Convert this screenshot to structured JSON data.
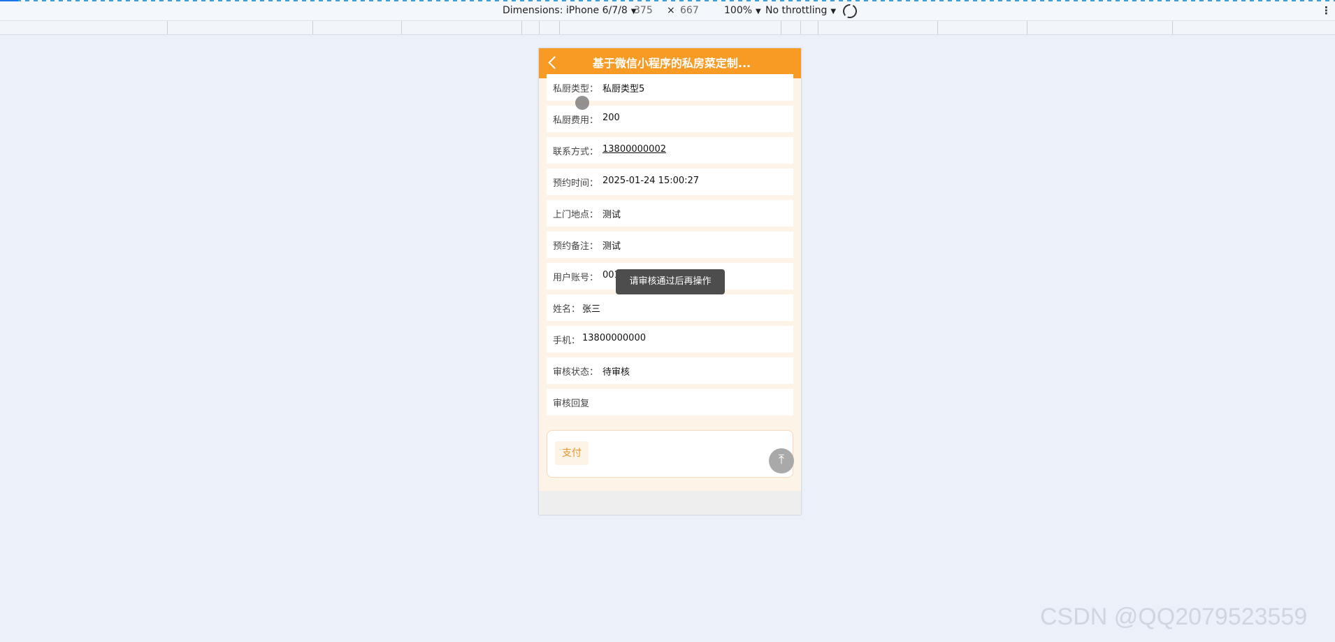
{
  "devtools": {
    "dimensions_label": "Dimensions: iPhone 6/7/8",
    "width": "375",
    "times": "×",
    "height": "667",
    "zoom": "100%",
    "throttling": "No throttling",
    "caret": "▼",
    "more": "⋮"
  },
  "nav": {
    "title": "基于微信小程序的私房菜定制..."
  },
  "fields": [
    {
      "label": "私厨类型：",
      "value": "私厨类型5"
    },
    {
      "label": "私厨费用：",
      "value": "200"
    },
    {
      "label": "联系方式：",
      "value": "13800000002"
    },
    {
      "label": "预约时间：",
      "value": "2025-01-24 15:00:27"
    },
    {
      "label": "上门地点：",
      "value": "测试"
    },
    {
      "label": "预约备注：",
      "value": "测试"
    },
    {
      "label": "用户账号：",
      "value": "001"
    },
    {
      "label": "姓名：",
      "value": "张三"
    },
    {
      "label": "手机：",
      "value": "13800000000"
    },
    {
      "label": "审核状态：",
      "value": "待审核"
    },
    {
      "label": "审核回复",
      "value": ""
    }
  ],
  "pay_button": "支付",
  "back_to_top_icon": "⤒",
  "toast": "请审核通过后再操作",
  "watermark": "CSDN @QQ2079523559"
}
